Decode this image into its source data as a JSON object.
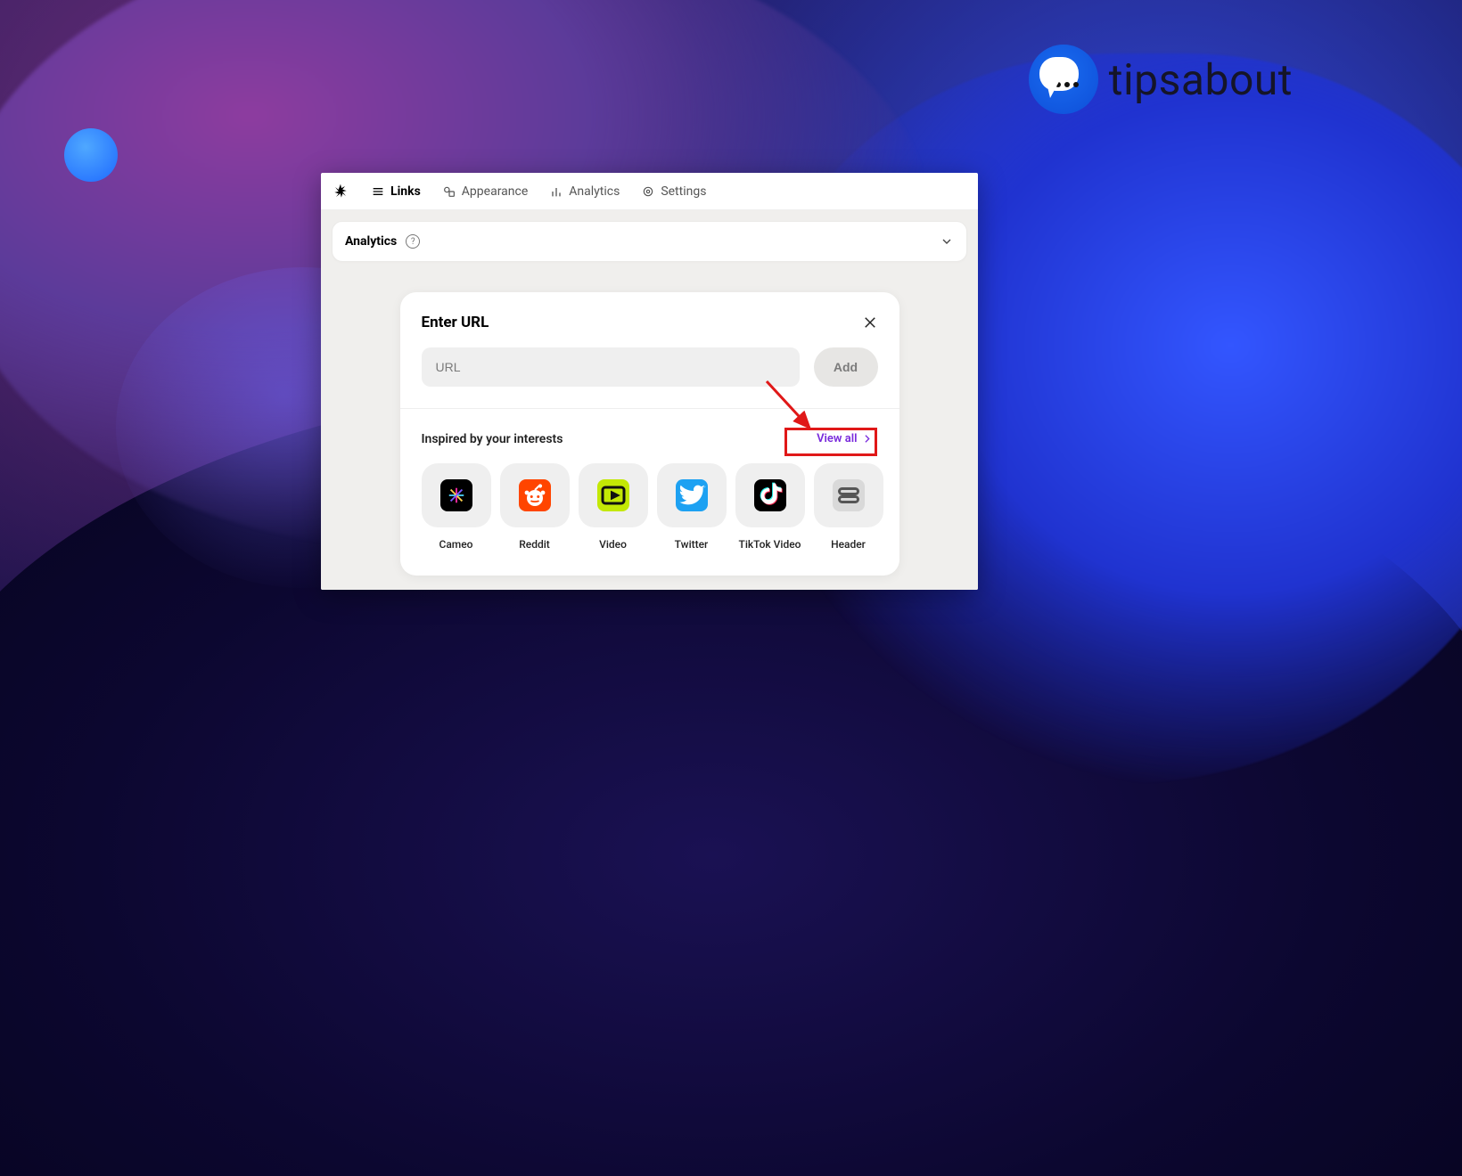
{
  "brand": {
    "name": "tipsabout"
  },
  "nav": {
    "links": "Links",
    "appearance": "Appearance",
    "analytics": "Analytics",
    "settings": "Settings"
  },
  "analytics_bar": {
    "title": "Analytics"
  },
  "card": {
    "title": "Enter URL",
    "url_placeholder": "URL",
    "add_label": "Add",
    "interests_title": "Inspired by your interests",
    "view_all_label": "View all",
    "tiles": {
      "cameo": "Cameo",
      "reddit": "Reddit",
      "video": "Video",
      "twitter": "Twitter",
      "tiktok": "TikTok Video",
      "header": "Header"
    }
  }
}
